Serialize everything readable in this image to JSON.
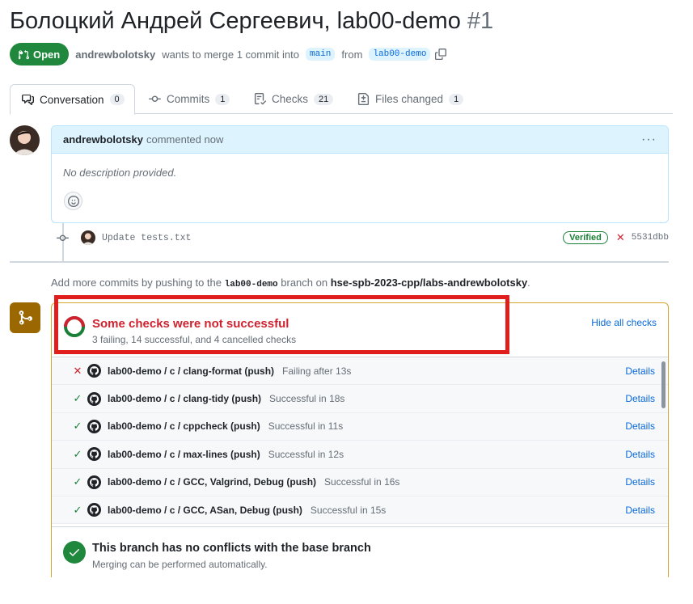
{
  "pr": {
    "title": "Болоцкий Андрей Сергеевич, lab00-demo",
    "number": "#1",
    "state": "Open",
    "author": "andrewbolotsky",
    "merge_text": "wants to merge 1 commit into",
    "base_branch": "main",
    "from_text": "from",
    "head_branch": "lab00-demo"
  },
  "tabs": [
    {
      "label": "Conversation",
      "count": "0",
      "icon": "comment-discussion-icon"
    },
    {
      "label": "Commits",
      "count": "1",
      "icon": "git-commit-icon"
    },
    {
      "label": "Checks",
      "count": "21",
      "icon": "checklist-icon"
    },
    {
      "label": "Files changed",
      "count": "1",
      "icon": "file-diff-icon"
    }
  ],
  "comment": {
    "author": "andrewbolotsky",
    "time": "commented now",
    "body": "No description provided."
  },
  "commit": {
    "message": "Update tests.txt",
    "verified": "Verified",
    "sha": "5531dbb"
  },
  "push_hint": {
    "prefix": "Add more commits by pushing to the",
    "branch": "lab00-demo",
    "middle": "branch on",
    "repo": "hse-spb-2023-cpp/labs-andrewbolotsky",
    "suffix": "."
  },
  "checks": {
    "title": "Some checks were not successful",
    "summary": "3 failing, 14 successful, and 4 cancelled checks",
    "hide_label": "Hide all checks",
    "details_label": "Details",
    "items": [
      {
        "status": "fail",
        "name": "lab00-demo / c / clang-format (push)",
        "result": "Failing after 13s"
      },
      {
        "status": "ok",
        "name": "lab00-demo / c / clang-tidy (push)",
        "result": "Successful in 18s"
      },
      {
        "status": "ok",
        "name": "lab00-demo / c / cppcheck (push)",
        "result": "Successful in 11s"
      },
      {
        "status": "ok",
        "name": "lab00-demo / c / max-lines (push)",
        "result": "Successful in 12s"
      },
      {
        "status": "ok",
        "name": "lab00-demo / c / GCC, Valgrind, Debug (push)",
        "result": "Successful in 16s"
      },
      {
        "status": "ok",
        "name": "lab00-demo / c / GCC, ASan, Debug (push)",
        "result": "Successful in 15s"
      }
    ]
  },
  "merge": {
    "title": "This branch has no conflicts with the base branch",
    "subtitle": "Merging can be performed automatically."
  },
  "colors": {
    "open_green": "#1f883d",
    "fail_red": "#cf222e",
    "link_blue": "#0969da",
    "warning_border": "#d4a72c",
    "annotation_red": "#e01e1e"
  }
}
